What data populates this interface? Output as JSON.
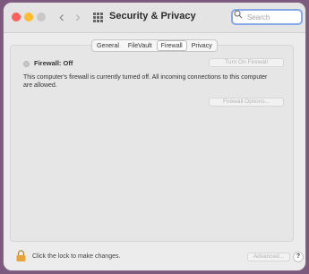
{
  "window": {
    "title": "Security & Privacy",
    "search": {
      "placeholder": "Search",
      "value": ""
    }
  },
  "tabs": [
    {
      "label": "General",
      "selected": false
    },
    {
      "label": "FileVault",
      "selected": false
    },
    {
      "label": "Firewall",
      "selected": true
    },
    {
      "label": "Privacy",
      "selected": false
    }
  ],
  "firewall": {
    "status_label": "Firewall: Off",
    "turn_on_label": "Turn On Firewall",
    "description": "This computer's firewall is currently turned off. All incoming connections to this computer are allowed.",
    "options_label": "Firewall Options..."
  },
  "footer": {
    "lock_text": "Click the lock to make changes.",
    "advanced_label": "Advanced...",
    "help_label": "?"
  },
  "icons": [
    "close-icon",
    "minimize-icon",
    "zoom-icon",
    "chevron-left-icon",
    "chevron-right-icon",
    "grid-icon",
    "search-icon",
    "status-dot-icon",
    "lock-icon",
    "help-icon"
  ],
  "colors": {
    "close": "#fe5f57",
    "minimize": "#febc2e",
    "search_focus": "#86a8e6",
    "lock": "#e8a43a"
  }
}
